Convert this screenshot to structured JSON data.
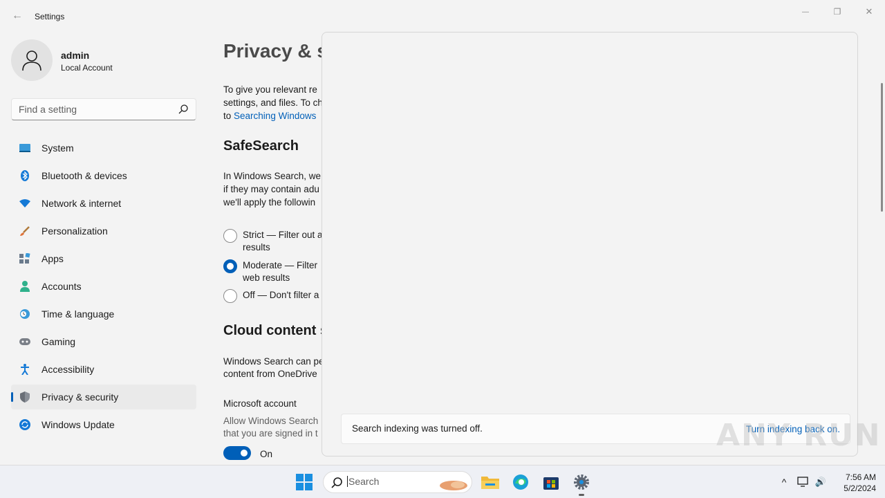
{
  "window": {
    "title": "Settings",
    "back_glyph": "←",
    "minimize_glyph": "—",
    "restore_glyph": "❐",
    "close_glyph": "✕"
  },
  "user": {
    "name": "admin",
    "account_type": "Local Account"
  },
  "sidebar": {
    "search_placeholder": "Find a setting",
    "items": [
      {
        "label": "System",
        "icon": "system-icon"
      },
      {
        "label": "Bluetooth & devices",
        "icon": "bluetooth-icon"
      },
      {
        "label": "Network & internet",
        "icon": "wifi-icon"
      },
      {
        "label": "Personalization",
        "icon": "brush-icon"
      },
      {
        "label": "Apps",
        "icon": "apps-icon"
      },
      {
        "label": "Accounts",
        "icon": "person-icon"
      },
      {
        "label": "Time & language",
        "icon": "clock-globe-icon"
      },
      {
        "label": "Gaming",
        "icon": "gamepad-icon"
      },
      {
        "label": "Accessibility",
        "icon": "accessibility-icon"
      },
      {
        "label": "Privacy & security",
        "icon": "shield-icon",
        "active": true
      },
      {
        "label": "Windows Update",
        "icon": "update-icon"
      }
    ]
  },
  "main": {
    "page_title": "Privacy & se",
    "intro_lines": [
      "To give you relevant re",
      "settings, and files. To ch"
    ],
    "intro_to": "to",
    "intro_link": "Searching Windows",
    "safesearch": {
      "heading": "SafeSearch",
      "desc_lines": [
        "In Windows Search, we",
        "if they may contain adu",
        "we'll apply the followin"
      ],
      "options": [
        {
          "line1": "Strict — Filter out a",
          "line2": "results",
          "checked": false
        },
        {
          "line1": "Moderate — Filter",
          "line2": "web results",
          "checked": true
        },
        {
          "line1": "Off — Don't filter a",
          "line2": "",
          "checked": false
        }
      ]
    },
    "cloud": {
      "heading": "Cloud content s",
      "desc_lines": [
        "Windows Search can pe",
        "content from OneDrive"
      ],
      "ms_account_label": "Microsoft account",
      "ms_account_desc": [
        "Allow Windows Search",
        "that you are signed in t"
      ],
      "toggle_state": "On"
    }
  },
  "overlay": {
    "notice_text": "Search indexing was turned off.",
    "notice_link": "Turn indexing back on.",
    "watermark": "ANY RUN"
  },
  "taskbar": {
    "search_placeholder": "Search",
    "time": "7:56 AM",
    "date": "5/2/2024",
    "tray_chevron": "^",
    "speaker_glyph": "🔊"
  },
  "colors": {
    "accent": "#005fb8"
  }
}
